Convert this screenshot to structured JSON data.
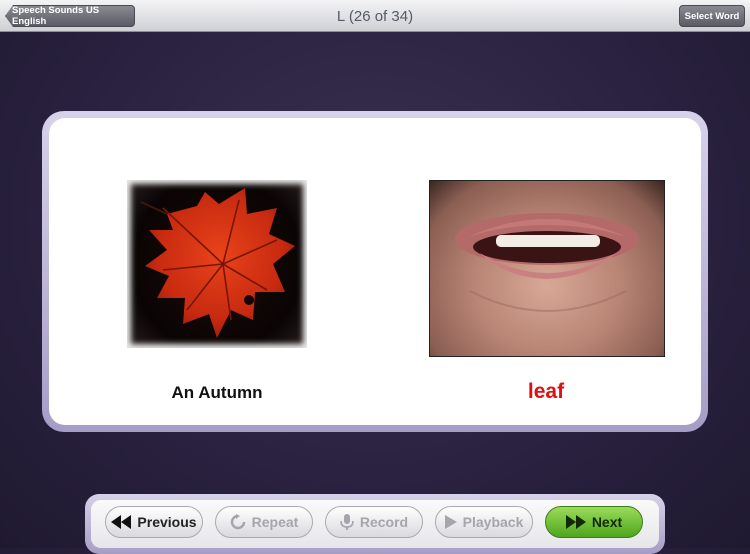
{
  "header": {
    "back_label": "Speech Sounds US English",
    "title": "L (26 of 34)",
    "select_label": "Select Word"
  },
  "card": {
    "left_caption": "An Autumn",
    "right_caption": "leaf",
    "left_image_icon": "leaf-image",
    "right_image_icon": "mouth-image",
    "highlight_color": "#e01010"
  },
  "controls": {
    "previous_label": "Previous",
    "repeat_label": "Repeat",
    "record_label": "Record",
    "playback_label": "Playback",
    "next_label": "Next",
    "next_color": "#4ea51c"
  }
}
